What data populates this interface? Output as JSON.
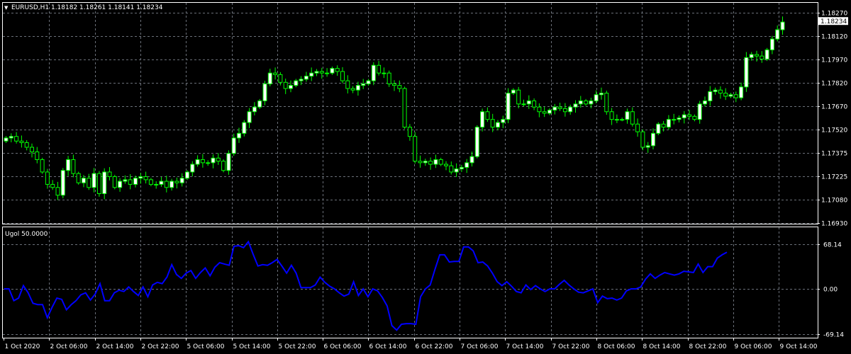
{
  "header": {
    "dropdown_glyph": "▼",
    "symbol_info": "EURUSD,H1  1.18182 1.18261 1.18141 1.18234",
    "indicator_title": "Ugol 50.0000"
  },
  "colors": {
    "background": "#000000",
    "grid": "#6b7079",
    "axes": "#ffffff",
    "bull_candle": "#ffffff",
    "bear_candle": "#000000",
    "candle_wick": "#00ff00",
    "indicator_line": "#0000ff"
  },
  "current_price": "1.18234",
  "chart_data": [
    {
      "type": "candlestick",
      "symbol": "EURUSD",
      "timeframe": "H1",
      "ylim": [
        1.1693,
        1.1829
      ],
      "y_tick_labels": [
        "1.18270",
        "1.18120",
        "1.17970",
        "1.17820",
        "1.17670",
        "1.17520",
        "1.17375",
        "1.17225",
        "1.17080",
        "1.16930"
      ],
      "x_tick_labels": [
        "1 Oct 2020",
        "2 Oct 06:00",
        "2 Oct 14:00",
        "2 Oct 22:00",
        "5 Oct 06:00",
        "5 Oct 14:00",
        "5 Oct 22:00",
        "6 Oct 06:00",
        "6 Oct 14:00",
        "6 Oct 22:00",
        "7 Oct 06:00",
        "7 Oct 14:00",
        "7 Oct 22:00",
        "8 Oct 06:00",
        "8 Oct 14:00",
        "8 Oct 22:00",
        "9 Oct 06:00",
        "9 Oct 14:00"
      ],
      "close": [
        1.1748,
        1.1749,
        1.1746,
        1.1745,
        1.1742,
        1.1739,
        1.1734,
        1.1726,
        1.1718,
        1.1716,
        1.1711,
        1.1727,
        1.1734,
        1.1725,
        1.1719,
        1.1722,
        1.1716,
        1.1725,
        1.1712,
        1.1726,
        1.1723,
        1.1716,
        1.172,
        1.1721,
        1.1718,
        1.1722,
        1.1723,
        1.1721,
        1.1718,
        1.1718,
        1.172,
        1.1716,
        1.172,
        1.1719,
        1.1722,
        1.1726,
        1.1731,
        1.1734,
        1.1732,
        1.1732,
        1.1735,
        1.1733,
        1.1727,
        1.1738,
        1.1748,
        1.1751,
        1.1758,
        1.1765,
        1.1768,
        1.1772,
        1.1783,
        1.179,
        1.1789,
        1.1784,
        1.178,
        1.1782,
        1.1785,
        1.1786,
        1.1788,
        1.179,
        1.1791,
        1.179,
        1.179,
        1.1793,
        1.1791,
        1.1785,
        1.178,
        1.1779,
        1.1782,
        1.1783,
        1.1785,
        1.1795,
        1.179,
        1.179,
        1.1783,
        1.1782,
        1.178,
        1.1755,
        1.1749,
        1.1733,
        1.1732,
        1.1733,
        1.1731,
        1.1734,
        1.1731,
        1.173,
        1.1726,
        1.1728,
        1.1729,
        1.1732,
        1.1736,
        1.1755,
        1.1765,
        1.176,
        1.1755,
        1.1758,
        1.176,
        1.1777,
        1.1779,
        1.177,
        1.177,
        1.1772,
        1.1768,
        1.1765,
        1.1764,
        1.1766,
        1.1768,
        1.1767,
        1.1765,
        1.1768,
        1.177,
        1.1772,
        1.177,
        1.1772,
        1.1776,
        1.1777,
        1.1765,
        1.176,
        1.176,
        1.176,
        1.1765,
        1.1757,
        1.1752,
        1.1742,
        1.1743,
        1.1751,
        1.1757,
        1.1755,
        1.176,
        1.176,
        1.1761,
        1.1763,
        1.1762,
        1.176,
        1.177,
        1.1772,
        1.1778,
        1.1779,
        1.1777,
        1.1775,
        1.1776,
        1.1774,
        1.1781,
        1.18,
        1.1802,
        1.1801,
        1.1799,
        1.1805,
        1.1812,
        1.1818,
        1.1823
      ]
    },
    {
      "type": "line",
      "name": "Ugol",
      "y_tick_labels": [
        "68.14",
        "0.00",
        "-69.14"
      ],
      "ylim": [
        -69.14,
        68.14
      ],
      "values": [
        0,
        0,
        -18,
        -14,
        5,
        -6,
        -22,
        -24,
        -24,
        -44,
        -28,
        -14,
        -16,
        -32,
        -24,
        -18,
        -9,
        -6,
        -17,
        -8,
        8,
        -18,
        -18,
        -6,
        -2,
        -4,
        3,
        -4,
        -10,
        3,
        -12,
        6,
        10,
        8,
        18,
        37,
        22,
        16,
        24,
        28,
        16,
        25,
        32,
        20,
        33,
        40,
        38,
        36,
        65,
        66,
        63,
        72,
        53,
        35,
        37,
        36,
        40,
        45,
        35,
        24,
        36,
        24,
        2,
        2,
        2,
        6,
        18,
        10,
        4,
        0,
        -6,
        -11,
        -8,
        11,
        -10,
        0,
        -12,
        0,
        -3,
        -13,
        -26,
        -56,
        -63,
        -54,
        -53,
        -53,
        -54,
        -12,
        0,
        6,
        30,
        52,
        52,
        41,
        42,
        42,
        64,
        64,
        58,
        40,
        41,
        35,
        24,
        11,
        5,
        11,
        4,
        -4,
        -6,
        6,
        -1,
        5,
        0,
        -4,
        0,
        0,
        7,
        13,
        6,
        0,
        -5,
        -6,
        -3,
        0,
        -21,
        -11,
        -15,
        -14,
        -17,
        -14,
        -3,
        0,
        0,
        3,
        15,
        23,
        16,
        21,
        25,
        23,
        21,
        23,
        27,
        26,
        25,
        38,
        25,
        34,
        34,
        47,
        52,
        56
      ]
    }
  ]
}
